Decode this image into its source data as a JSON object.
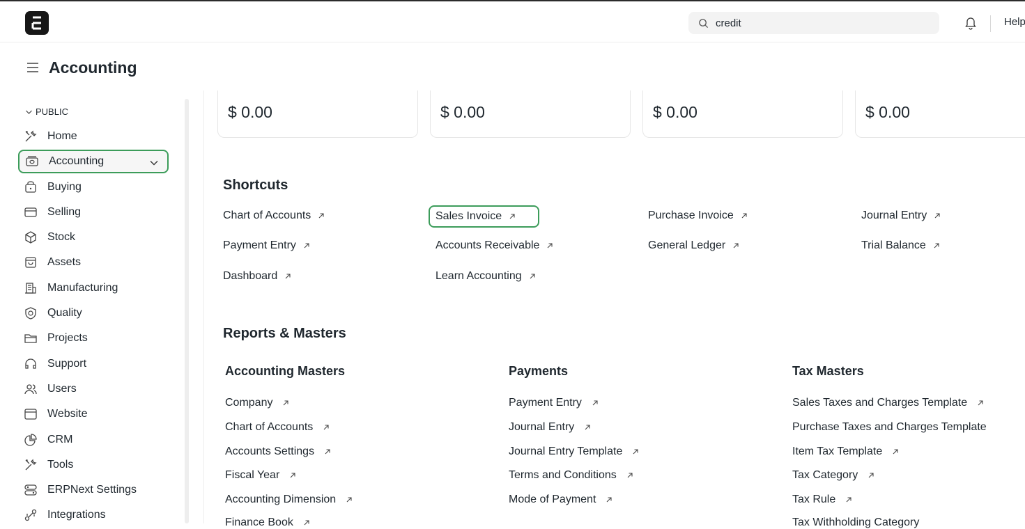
{
  "navbar": {
    "logo_letter": "E",
    "search": {
      "value": "credit",
      "placeholder": ""
    },
    "help_label": "Help"
  },
  "page": {
    "title": "Accounting"
  },
  "sidebar": {
    "section": "PUBLIC",
    "items": [
      {
        "label": "Home",
        "icon": "tools-icon"
      },
      {
        "label": "Accounting",
        "icon": "wallet-icon",
        "active": true
      },
      {
        "label": "Buying",
        "icon": "shopping-bag-icon"
      },
      {
        "label": "Selling",
        "icon": "card-icon"
      },
      {
        "label": "Stock",
        "icon": "cube-icon"
      },
      {
        "label": "Assets",
        "icon": "asset-icon"
      },
      {
        "label": "Manufacturing",
        "icon": "factory-icon"
      },
      {
        "label": "Quality",
        "icon": "shield-icon"
      },
      {
        "label": "Projects",
        "icon": "folder-icon"
      },
      {
        "label": "Support",
        "icon": "headset-icon"
      },
      {
        "label": "Users",
        "icon": "users-icon"
      },
      {
        "label": "Website",
        "icon": "browser-icon"
      },
      {
        "label": "CRM",
        "icon": "pie-chart-icon"
      },
      {
        "label": "Tools",
        "icon": "tools-icon"
      },
      {
        "label": "ERPNext Settings",
        "icon": "settings-icon"
      },
      {
        "label": "Integrations",
        "icon": "integration-icon"
      }
    ]
  },
  "cards": [
    "$ 0.00",
    "$ 0.00",
    "$ 0.00",
    "$ 0.00"
  ],
  "shortcuts": {
    "title": "Shortcuts",
    "items": [
      "Chart of Accounts",
      "Sales Invoice",
      "Purchase Invoice",
      "Journal Entry",
      "Payment Entry",
      "Accounts Receivable",
      "General Ledger",
      "Trial Balance",
      "Dashboard",
      "Learn Accounting"
    ]
  },
  "reports": {
    "title": "Reports & Masters",
    "groups": [
      {
        "title": "Accounting Masters",
        "items": [
          "Company",
          "Chart of Accounts",
          "Accounts Settings",
          "Fiscal Year",
          "Accounting Dimension",
          "Finance Book"
        ]
      },
      {
        "title": "Payments",
        "items": [
          "Payment Entry",
          "Journal Entry",
          "Journal Entry Template",
          "Terms and Conditions",
          "Mode of Payment"
        ]
      },
      {
        "title": "Tax Masters",
        "items": [
          "Sales Taxes and Charges Template",
          "Purchase Taxes and Charges Template",
          "Item Tax Template",
          "Tax Category",
          "Tax Rule",
          "Tax Withholding Category"
        ]
      }
    ]
  }
}
